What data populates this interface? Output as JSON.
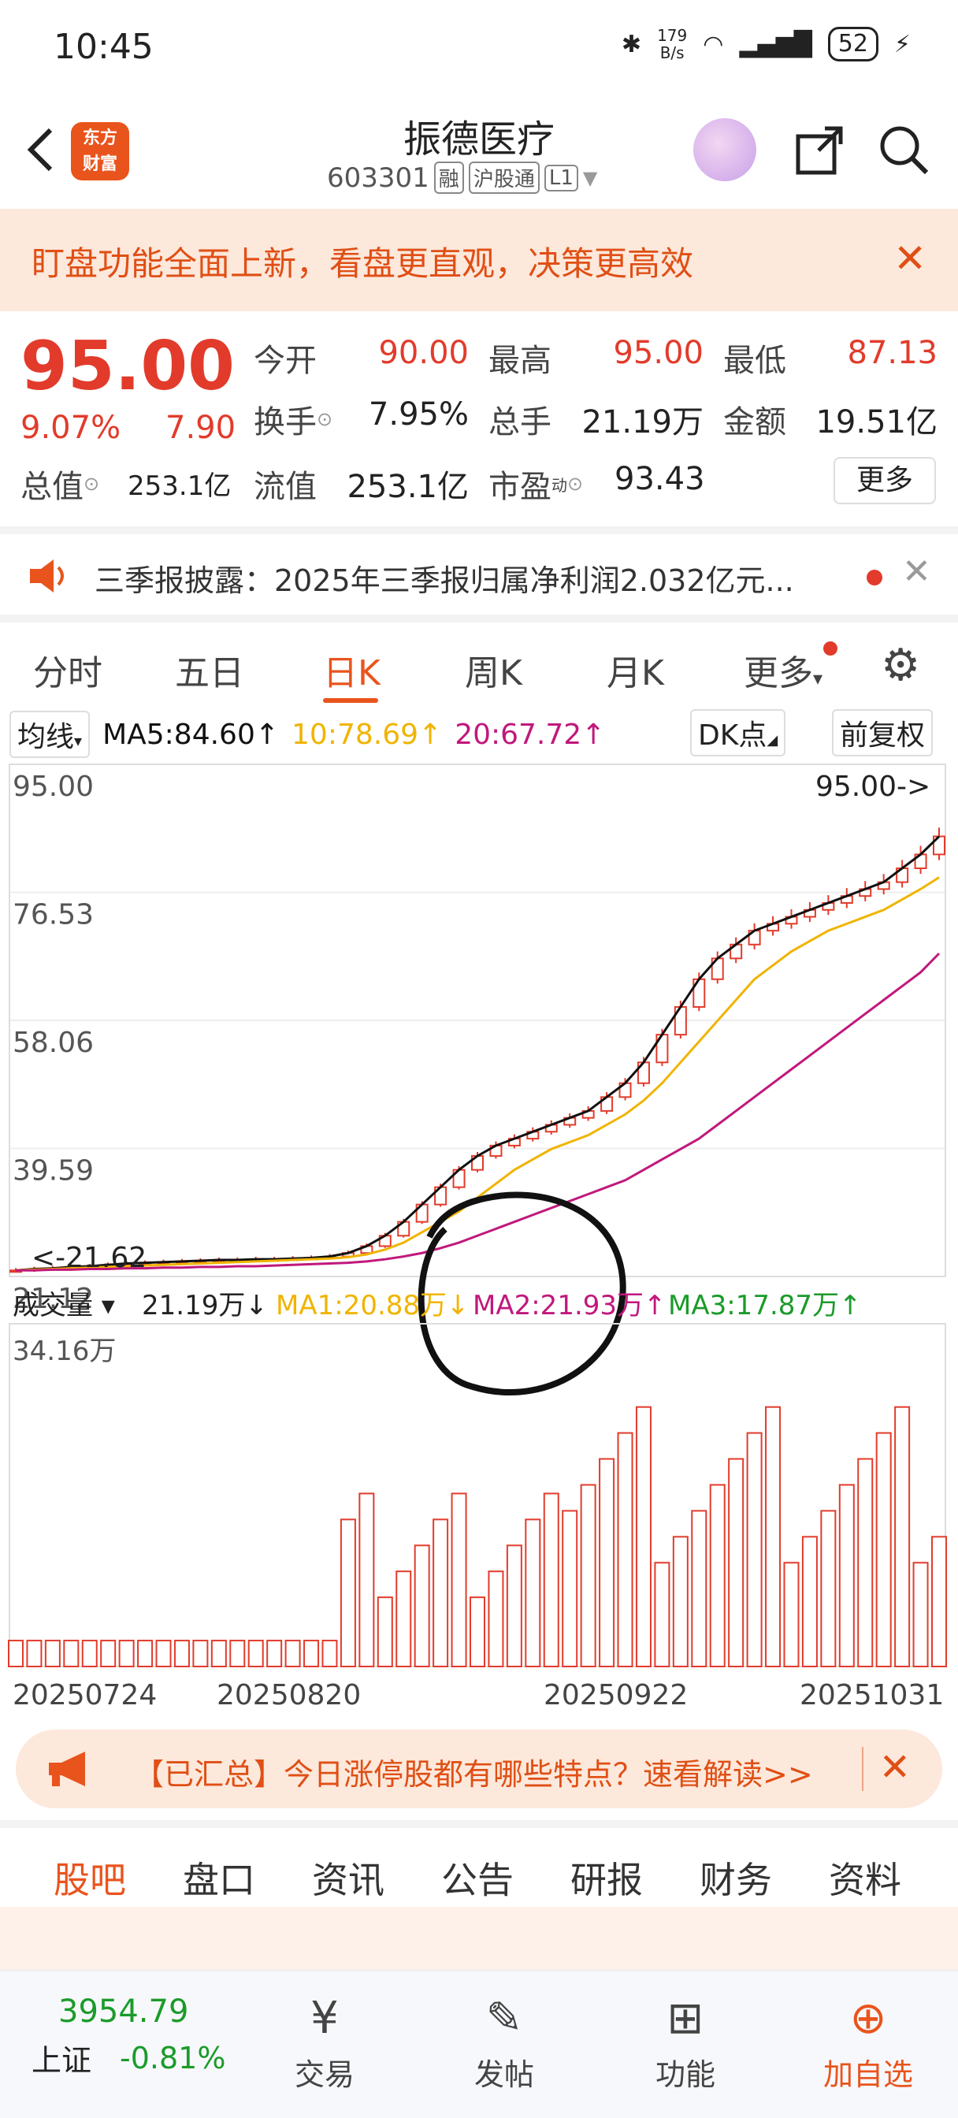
{
  "status_bar": {
    "time": "10:45",
    "net_speed": "179\nB/s",
    "battery": "52"
  },
  "header": {
    "logo_line1": "东方",
    "logo_line2": "财富",
    "title": "振德医疗",
    "code": "603301",
    "tags": [
      "融",
      "沪股通",
      "L1"
    ]
  },
  "banner": {
    "text": "盯盘功能全面上新，看盘更直观，决策更高效"
  },
  "quote": {
    "price": "95.00",
    "change_pct": "9.07%",
    "change_amt": "7.90",
    "open_label": "今开",
    "open": "90.00",
    "high_label": "最高",
    "high": "95.00",
    "low_label": "最低",
    "low": "87.13",
    "turnover_label": "换手",
    "turnover": "7.95%",
    "volume_label": "总手",
    "volume": "21.19万",
    "amount_label": "金额",
    "amount": "19.51亿",
    "mcap_label": "总值",
    "mcap": "253.1亿",
    "float_label": "流值",
    "float": "253.1亿",
    "pe_label": "市盈",
    "pe_sup": "动",
    "pe": "93.43",
    "more": "更多"
  },
  "news": {
    "text": "三季报披露：2025年三季报归属净利润2.032亿元..."
  },
  "tabs": [
    "分时",
    "五日",
    "日K",
    "周K",
    "月K",
    "更多"
  ],
  "chart_toolbar": {
    "ma_select": "均线",
    "ma5": "MA5:84.60↑",
    "ma10": "10:78.69↑",
    "ma20": "20:67.72↑",
    "dk": "DK点",
    "restore": "前复权"
  },
  "chart_labels": {
    "y_ticks": [
      "95.00",
      "76.53",
      "58.06",
      "39.59",
      "21.12"
    ],
    "last_price_tag": "95.00->",
    "low_tag": "<-21.62",
    "vol_select": "成交量",
    "vol_now": "21.19万↓",
    "vol_ma1": "MA1:20.88万↓",
    "vol_ma2": "MA2:21.93万↑",
    "vol_ma3": "MA3:17.87万↑",
    "vol_max": "34.16万",
    "dates": [
      "20250724",
      "20250820",
      "20250922",
      "20251031"
    ]
  },
  "colors": {
    "up": "#e23b2b",
    "down": "#1a9b2a",
    "accent": "#e9541d",
    "ma5": "#111111",
    "ma10": "#f0b400",
    "ma20": "#c0187c"
  },
  "chart_data": {
    "type": "line",
    "title": "",
    "note": "Daily K-line with MA5/MA10/MA20 and volume; closes approximated",
    "ylim": [
      21.12,
      95.0
    ],
    "series": [
      {
        "name": "MA5",
        "values": [
          22,
          22.2,
          22.3,
          22.5,
          22.6,
          22.8,
          23,
          23.1,
          23.2,
          23.3,
          23.4,
          23.5,
          23.5,
          23.6,
          23.6,
          23.7,
          23.8,
          24,
          24.5,
          25.5,
          27,
          29,
          31.5,
          34,
          36.5,
          38.5,
          40,
          41,
          42,
          43,
          44,
          45,
          47,
          49,
          52,
          56,
          60,
          64,
          67,
          69,
          71,
          72,
          73,
          74,
          75,
          76,
          77,
          78,
          80,
          82,
          84.6
        ]
      },
      {
        "name": "10",
        "values": [
          22,
          22.1,
          22.2,
          22.3,
          22.4,
          22.5,
          22.6,
          22.7,
          22.8,
          22.9,
          23,
          23.1,
          23.2,
          23.3,
          23.4,
          23.5,
          23.6,
          23.7,
          23.9,
          24.3,
          25,
          26,
          27.5,
          29,
          30.5,
          32.5,
          34.5,
          36.5,
          38,
          39.5,
          40.5,
          41.5,
          43,
          44.5,
          46.5,
          49,
          52,
          55,
          58,
          61,
          64,
          66,
          68,
          69.5,
          71,
          72,
          73,
          74,
          75.5,
          77,
          78.69
        ]
      },
      {
        "name": "20",
        "values": [
          22,
          22,
          22.1,
          22.1,
          22.2,
          22.2,
          22.3,
          22.3,
          22.4,
          22.4,
          22.5,
          22.5,
          22.6,
          22.6,
          22.7,
          22.8,
          22.9,
          23,
          23.1,
          23.3,
          23.6,
          24,
          24.5,
          25.2,
          26,
          27,
          28,
          29,
          30,
          31,
          32,
          33,
          34,
          35,
          36.5,
          38,
          39.5,
          41,
          43,
          45,
          47,
          49,
          51,
          53,
          55,
          57,
          59,
          61,
          63,
          65,
          67.72
        ]
      }
    ],
    "volume_ylim": [
      0,
      34.16
    ]
  },
  "promo": {
    "text": "【已汇总】今日涨停股都有哪些特点？速看解读>>"
  },
  "bottom_tabs": [
    "股吧",
    "盘口",
    "资讯",
    "公告",
    "研报",
    "财务",
    "资料"
  ],
  "bottom_nav": {
    "index_value": "3954.79",
    "index_name": "上证",
    "index_change": "-0.81%",
    "trade": "交易",
    "post": "发帖",
    "function": "功能",
    "add": "加自选"
  }
}
